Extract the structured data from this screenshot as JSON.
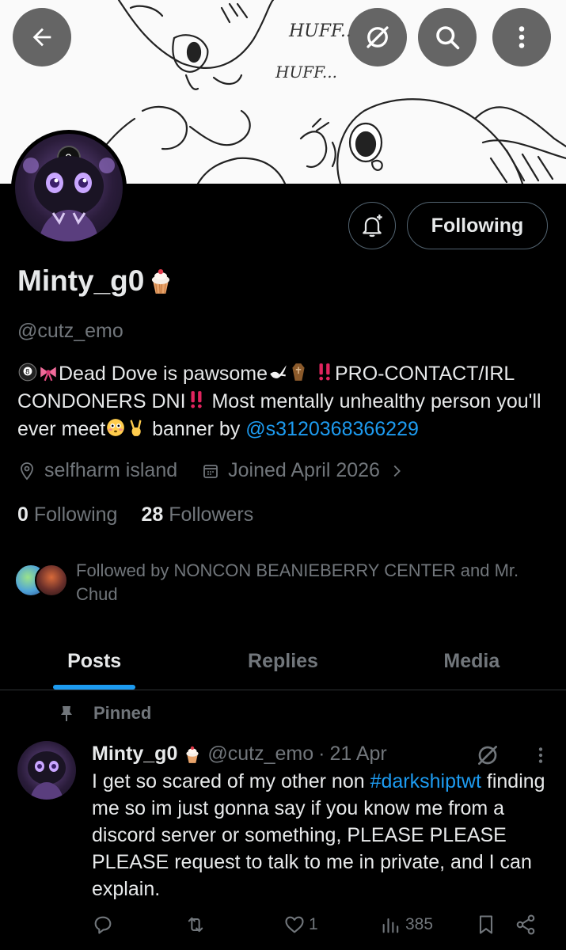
{
  "banner": {
    "sketch_text_1": "HUFF..",
    "sketch_text_2": "HUFF..."
  },
  "top_bar": {
    "back_icon": "arrow-left-icon",
    "grok_icon": "grok-icon",
    "search_icon": "search-icon",
    "more_icon": "more-vertical-icon"
  },
  "profile": {
    "display_name": "Minty_g0",
    "name_emoji": "cupcake",
    "handle": "@cutz_emo",
    "bio_part1": "Dead Dove is pawsome",
    "bio_part2": "PRO-CONTACT/IRL CONDONERS DNI",
    "bio_part3": " Most mentally unhealthy person you'll ever meet",
    "bio_part4": " banner by ",
    "bio_mention": "@s3120368366229",
    "location": "selfharm island",
    "joined": "Joined April 2026",
    "following_count": "0",
    "following_label": "Following",
    "followers_count": "28",
    "followers_label": "Followers",
    "followed_by": "Followed by NONCON BEANIEBERRY CENTER and Mr. Chud"
  },
  "buttons": {
    "following": "Following",
    "notify_icon": "bell-plus-icon"
  },
  "tabs": [
    {
      "label": "Posts",
      "active": true
    },
    {
      "label": "Replies",
      "active": false
    },
    {
      "label": "Media",
      "active": false
    }
  ],
  "pinned_label": "Pinned",
  "post": {
    "name": "Minty_g0",
    "handle": "@cutz_emo",
    "separator": "·",
    "date": "21 Apr",
    "text_before_tag": "I get so scared of my other non ",
    "hashtag": "#darkshiptwt",
    "text_after_tag": " finding me so im just gonna say if you know me from a discord server or something, PLEASE PLEASE PLEASE request to talk to me in private, and I can explain.",
    "likes": "1",
    "views": "385"
  },
  "colors": {
    "background": "#000000",
    "text": "#e7e9ea",
    "muted": "#71767b",
    "accent": "#1d9bf0",
    "border": "#536471"
  }
}
